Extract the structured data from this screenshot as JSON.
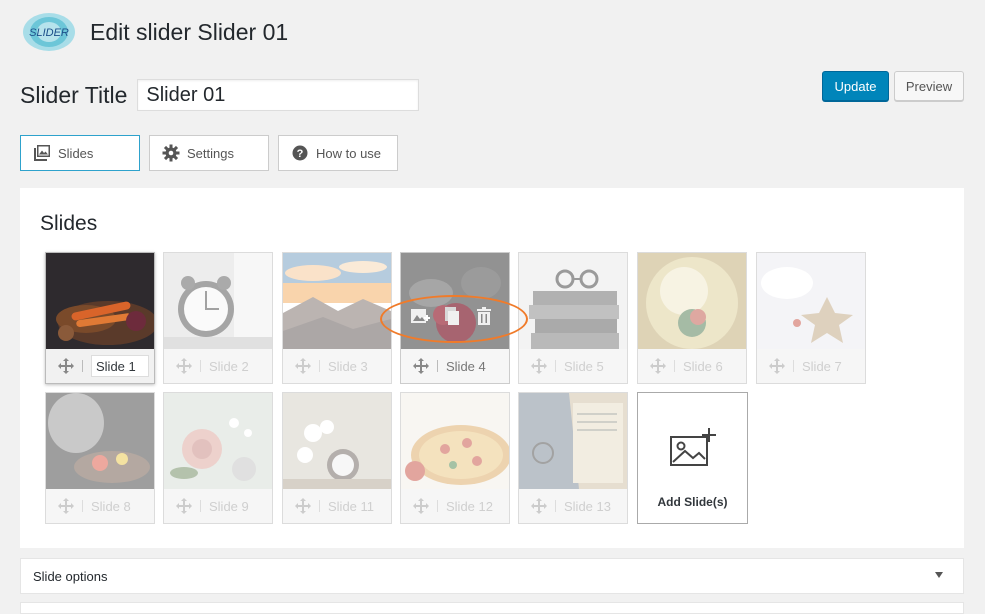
{
  "header": {
    "logo_text": "SLIDER",
    "title": "Edit slider Slider 01"
  },
  "title_field": {
    "label": "Slider Title",
    "value": "Slider 01"
  },
  "actions": {
    "update_label": "Update",
    "preview_label": "Preview"
  },
  "tabs": [
    {
      "label": "Slides",
      "icon": "image-gallery-icon",
      "active": true
    },
    {
      "label": "Settings",
      "icon": "gear-icon",
      "active": false
    },
    {
      "label": "How to use",
      "icon": "question-circle-icon",
      "active": false
    }
  ],
  "slides_panel": {
    "title": "Slides",
    "slides": [
      {
        "label": "Slide 1"
      },
      {
        "label": "Slide 2"
      },
      {
        "label": "Slide 3"
      },
      {
        "label": "Slide 4"
      },
      {
        "label": "Slide 5"
      },
      {
        "label": "Slide 6"
      },
      {
        "label": "Slide 7"
      },
      {
        "label": "Slide 8"
      },
      {
        "label": "Slide 9"
      },
      {
        "label": "Slide 11"
      },
      {
        "label": "Slide 12"
      },
      {
        "label": "Slide 13"
      }
    ],
    "add_label": "Add Slide(s)"
  },
  "slide_options": {
    "label": "Slide options"
  },
  "colors": {
    "accent": "#0085ba",
    "highlight": "#f07b2a",
    "active_tab_border": "#2ea2cc"
  }
}
